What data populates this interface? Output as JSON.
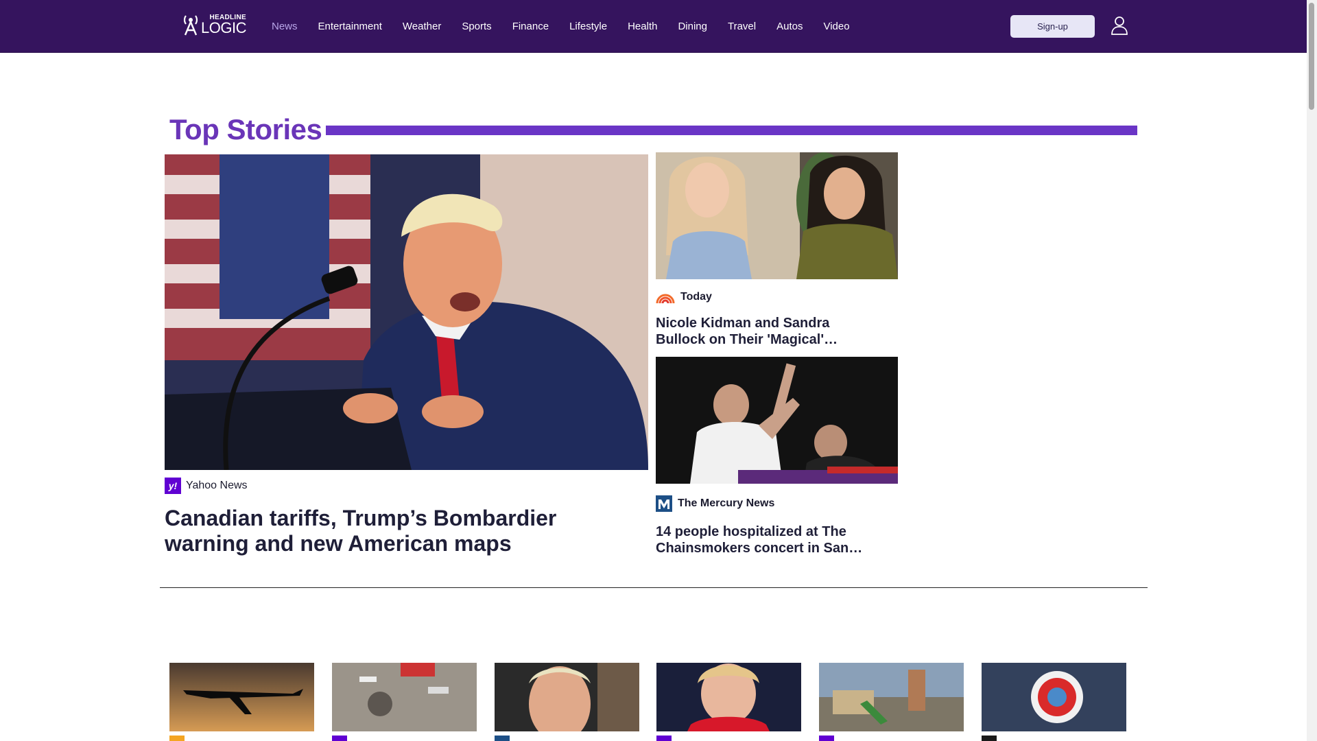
{
  "header": {
    "logo_small": "HEADLINE",
    "logo_big": "LOGIC",
    "nav": [
      {
        "label": "News",
        "active": true
      },
      {
        "label": "Entertainment",
        "active": false
      },
      {
        "label": "Weather",
        "active": false
      },
      {
        "label": "Sports",
        "active": false
      },
      {
        "label": "Finance",
        "active": false
      },
      {
        "label": "Lifestyle",
        "active": false
      },
      {
        "label": "Health",
        "active": false
      },
      {
        "label": "Dining",
        "active": false
      },
      {
        "label": "Travel",
        "active": false
      },
      {
        "label": "Autos",
        "active": false
      },
      {
        "label": "Video",
        "active": false
      }
    ],
    "signup_label": "Sign-up",
    "user_icon": "user-icon"
  },
  "top_stories": {
    "title": "Top Stories",
    "lead": {
      "source": "Yahoo News",
      "source_icon": "yahoo-icon",
      "headline": "Canadian tariffs, Trump’s Bombardier warning and new American maps"
    },
    "side": [
      {
        "source": "Today",
        "source_icon": "today-rainbow-icon",
        "headline": "Nicole Kidman and Sandra Bullock on Their 'Magical'…"
      },
      {
        "source": "The Mercury News",
        "source_icon": "mercury-news-icon",
        "headline": "14 people hospitalized at The Chainsmokers concert in San…"
      }
    ]
  },
  "colors": {
    "header_bg": "#35145e",
    "accent": "#6a35c6",
    "signup_bg": "#e7e6f6"
  }
}
